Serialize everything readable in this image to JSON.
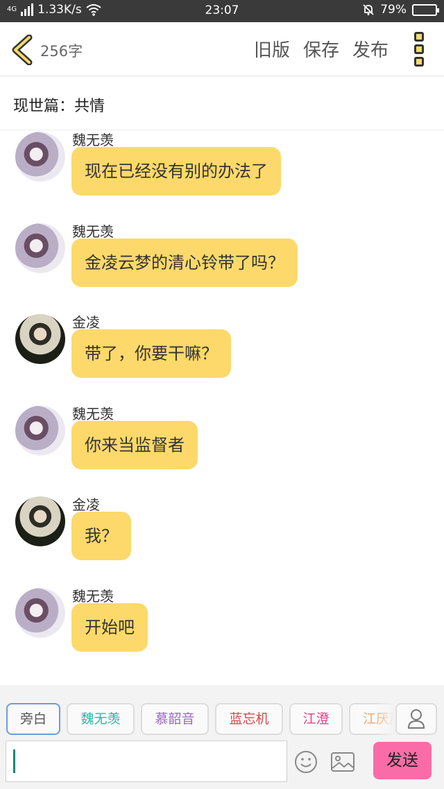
{
  "status_bar": {
    "network": "4G",
    "speed": "1.33K/s",
    "time": "23:07",
    "battery": "79%",
    "battery_level": 0.79
  },
  "header": {
    "back_icon": "chevron-left-icon",
    "word_count": "256字",
    "buttons": {
      "old_version": "旧版",
      "save": "保存",
      "publish": "发布"
    },
    "menu_icon": "more-vertical-icon",
    "accent": "#fcd96a"
  },
  "title": "现世篇：共情",
  "messages": [
    {
      "sender": "魏无羡",
      "text": "现在已经没有别的办法了",
      "avatar": "wei"
    },
    {
      "sender": "魏无羡",
      "text": "金凌云梦的清心铃带了吗？",
      "avatar": "wei"
    },
    {
      "sender": "金凌",
      "text": "带了，你要干嘛？",
      "avatar": "jin"
    },
    {
      "sender": "魏无羡",
      "text": "你来当监督者",
      "avatar": "wei"
    },
    {
      "sender": "金凌",
      "text": "我？",
      "avatar": "jin"
    },
    {
      "sender": "魏无羡",
      "text": "开始吧",
      "avatar": "wei"
    }
  ],
  "roles": [
    {
      "name": "旁白",
      "color": "#555555"
    },
    {
      "name": "魏无羡",
      "color": "#2fb5a4"
    },
    {
      "name": "慕韶音",
      "color": "#9a6cc4"
    },
    {
      "name": "蓝忘机",
      "color": "#d34a4a"
    },
    {
      "name": "江澄",
      "color": "#e0408c"
    },
    {
      "name": "江厌离",
      "color": "#f2a56e"
    }
  ],
  "composer": {
    "input_value": "",
    "emoji_icon": "emoji-icon",
    "image_icon": "image-icon",
    "send_label": "发送",
    "send_color": "#f96ca7"
  }
}
